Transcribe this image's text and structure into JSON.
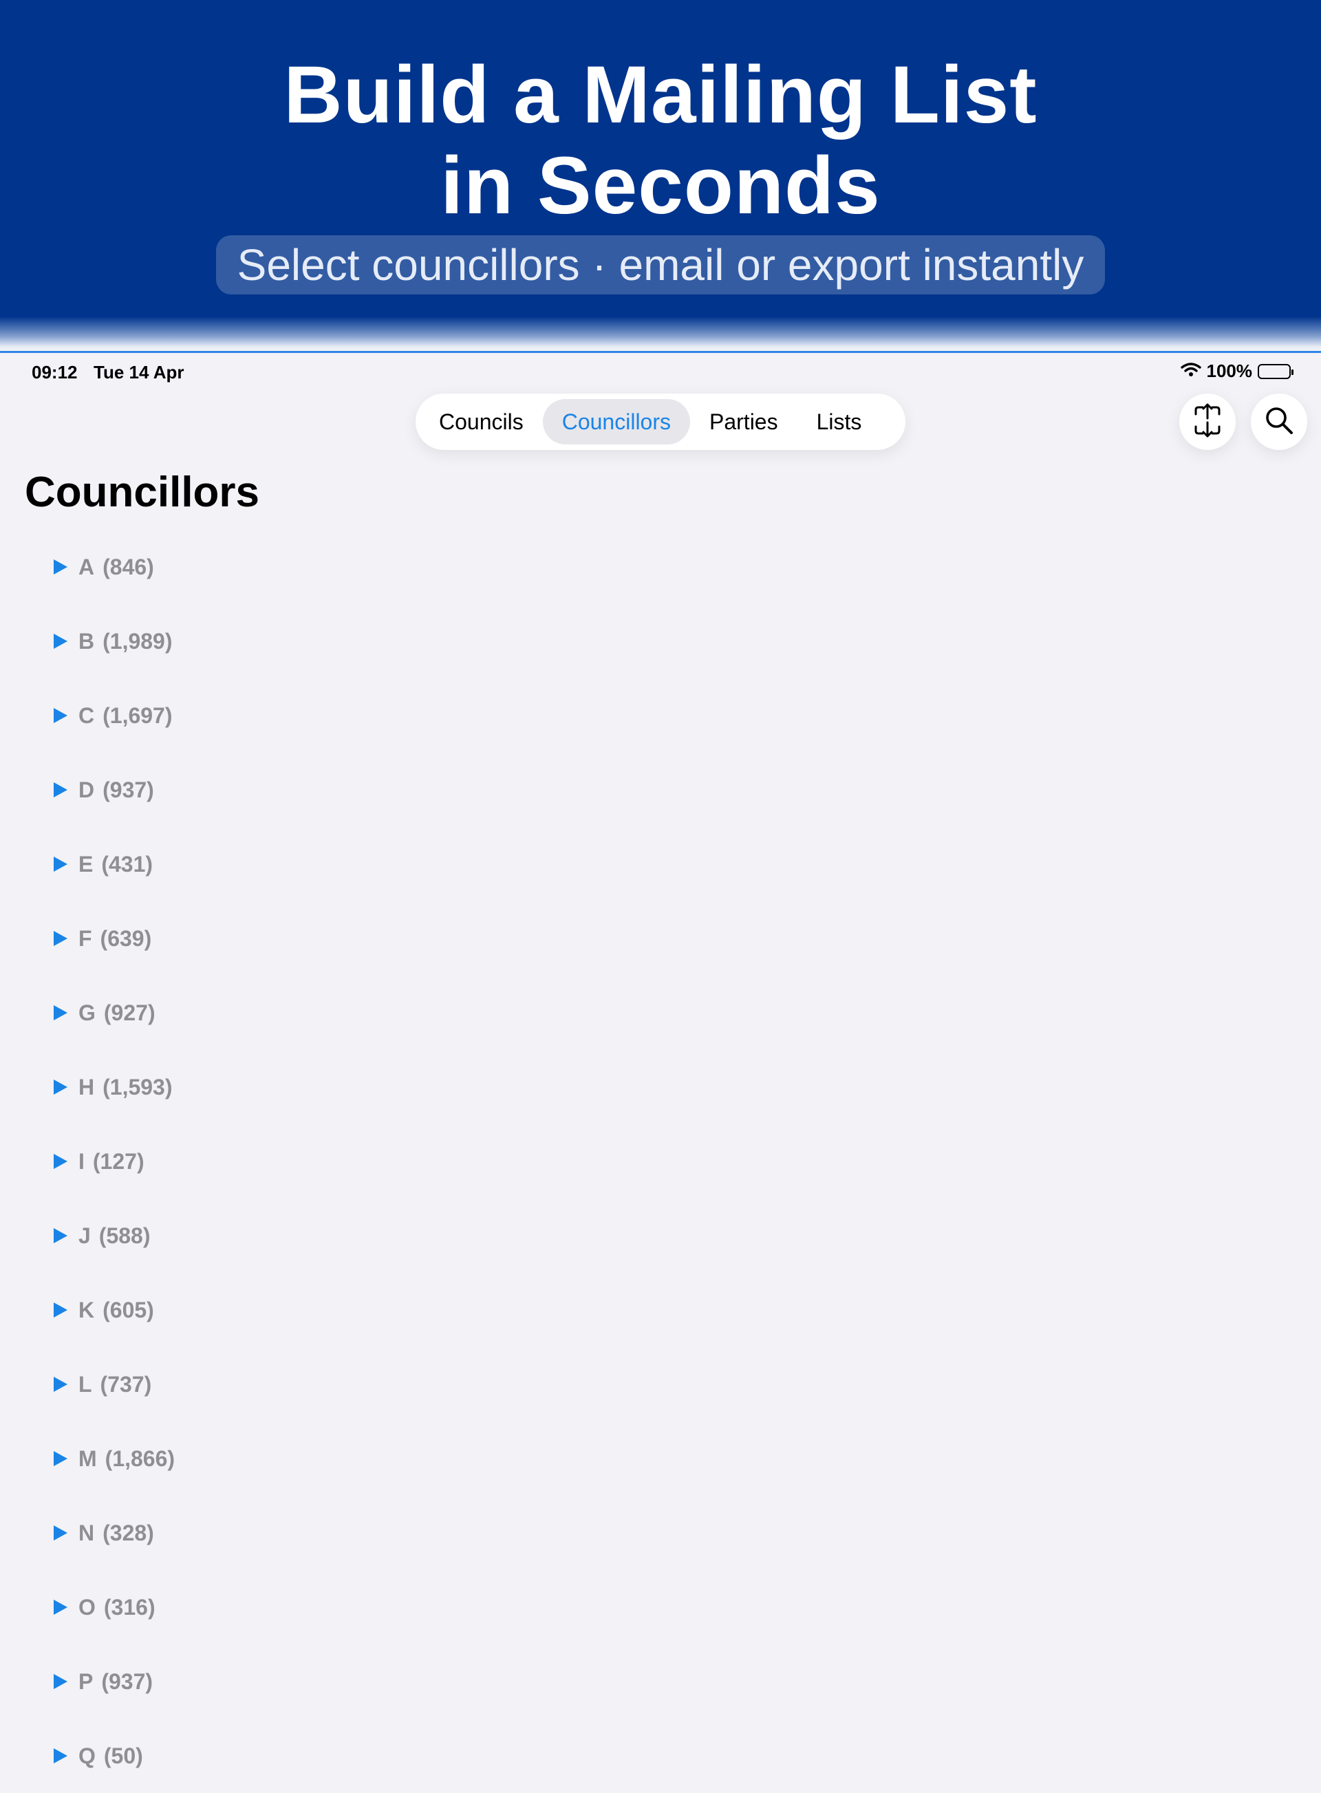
{
  "promo": {
    "title_line1": "Build a Mailing List",
    "title_line2": "in Seconds",
    "subtitle": "Select councillors · email or export instantly"
  },
  "status_bar": {
    "time": "09:12",
    "date": "Tue 14 Apr",
    "battery": "100%"
  },
  "tabs": [
    {
      "label": "Councils",
      "active": false
    },
    {
      "label": "Councillors",
      "active": true
    },
    {
      "label": "Parties",
      "active": false
    },
    {
      "label": "Lists",
      "active": false
    }
  ],
  "toolbar": {
    "export_icon": "export-arrows-icon",
    "search_icon": "search-icon"
  },
  "page": {
    "title": "Councillors"
  },
  "groups": [
    {
      "letter": "A",
      "count": "(846)"
    },
    {
      "letter": "B",
      "count": "(1,989)"
    },
    {
      "letter": "C",
      "count": "(1,697)"
    },
    {
      "letter": "D",
      "count": "(937)"
    },
    {
      "letter": "E",
      "count": "(431)"
    },
    {
      "letter": "F",
      "count": "(639)"
    },
    {
      "letter": "G",
      "count": "(927)"
    },
    {
      "letter": "H",
      "count": "(1,593)"
    },
    {
      "letter": "I",
      "count": "(127)"
    },
    {
      "letter": "J",
      "count": "(588)"
    },
    {
      "letter": "K",
      "count": "(605)"
    },
    {
      "letter": "L",
      "count": "(737)"
    },
    {
      "letter": "M",
      "count": "(1,866)"
    },
    {
      "letter": "N",
      "count": "(328)"
    },
    {
      "letter": "O",
      "count": "(316)"
    },
    {
      "letter": "P",
      "count": "(937)"
    },
    {
      "letter": "Q",
      "count": "(50)"
    }
  ],
  "colors": {
    "banner": "#00348d",
    "accent": "#1a84e6",
    "background": "#f2f2f7"
  }
}
